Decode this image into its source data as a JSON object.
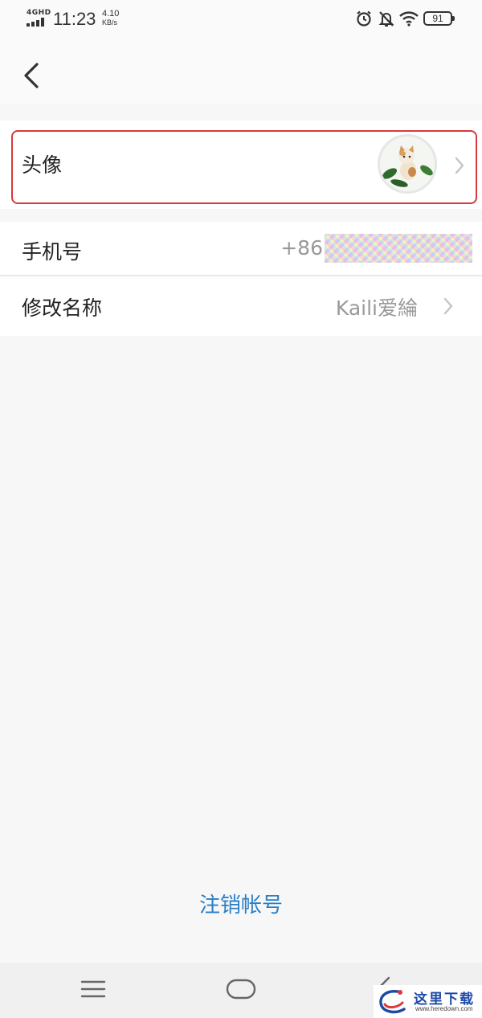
{
  "status_bar": {
    "network": "4GHD",
    "time": "11:23",
    "speed_value": "4.10",
    "speed_unit": "KB/s",
    "battery": "91",
    "icons": [
      "alarm-icon",
      "mute-icon",
      "wifi-icon",
      "battery-icon"
    ]
  },
  "nav": {
    "back_icon": "chevron-left-icon"
  },
  "settings": {
    "avatar_label": "头像",
    "phone_label": "手机号",
    "phone_prefix": "+86",
    "rename_label": "修改名称",
    "name_value": "Kaili爱綸"
  },
  "actions": {
    "logout_label": "注销帐号"
  },
  "system_nav": {
    "icons": [
      "menu-icon",
      "home-icon",
      "back-icon"
    ]
  },
  "watermark": {
    "text": "这里下载",
    "url": "www.heredown.com"
  },
  "colors": {
    "accent": "#2a7fc6",
    "highlight_border": "#d9393b",
    "background": "#f7f7f7"
  }
}
